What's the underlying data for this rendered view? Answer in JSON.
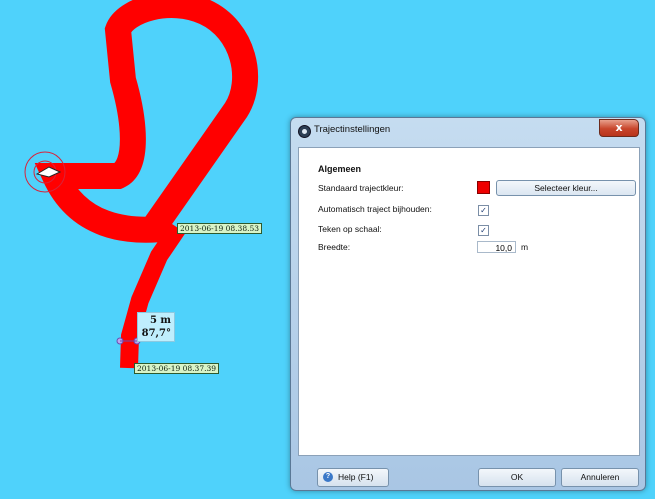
{
  "map": {
    "background_color": "#4fd2fb",
    "track_color": "#ff0000",
    "timestamp_top": "2013-06-19 08.38.53",
    "timestamp_bottom": "2013-06-19 08.37.39",
    "measure_distance": "5 m",
    "measure_angle": "87,7°"
  },
  "dialog": {
    "title": "Trajectinstellingen",
    "close_label": "x",
    "section_title": "Algemeen",
    "rows": {
      "default_color_label": "Standaard trajectkleur:",
      "select_color_button": "Selecteer kleur...",
      "auto_track_label": "Automatisch traject bijhouden:",
      "auto_track_checked": true,
      "draw_to_scale_label": "Teken op schaal:",
      "draw_to_scale_checked": true,
      "width_label": "Breedte:",
      "width_value": "10,0",
      "width_unit": "m"
    },
    "swatch_color": "#ee0000",
    "help_button": "Help (F1)",
    "ok_button": "OK",
    "cancel_button": "Annuleren"
  }
}
